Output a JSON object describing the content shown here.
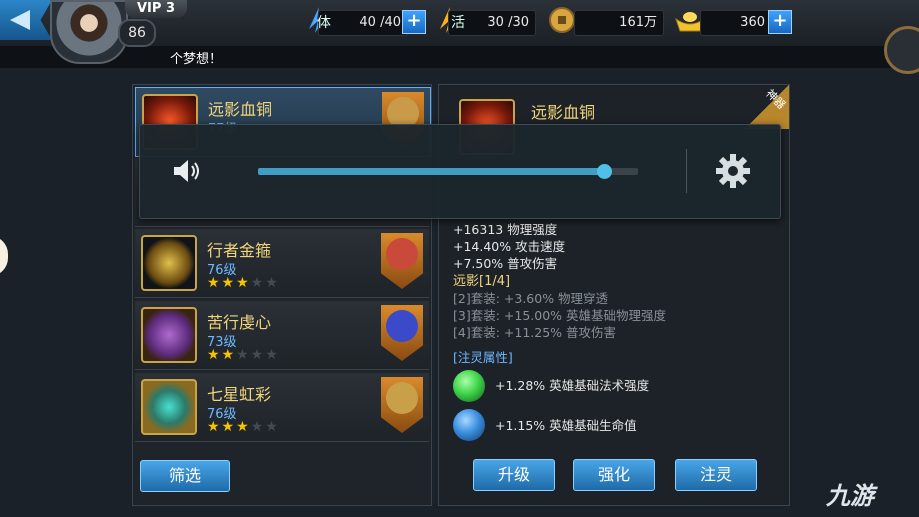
{
  "header": {
    "vip_label": "VIP 3",
    "player_level": "86",
    "stamina": {
      "icon": "stamina-icon",
      "label": "体",
      "value": "40 /40"
    },
    "vitality": {
      "icon": "vitality-icon",
      "label": "活",
      "value": "30 /30"
    },
    "coins": {
      "icon": "coin-icon",
      "value": "161万"
    },
    "ingots": {
      "icon": "ingot-icon",
      "value": "360"
    },
    "message": "个梦想！"
  },
  "equipment_list": [
    {
      "name": "远影血铜",
      "level": "77级",
      "stars": 0,
      "selected": true,
      "hero_color": "#c99a4a"
    },
    {
      "name": "",
      "level": "",
      "stars": 0,
      "selected": false,
      "hero_color": "#333"
    },
    {
      "name": "行者金箍",
      "level": "76级",
      "stars": 3,
      "selected": false,
      "hero_color": "#c94a3a"
    },
    {
      "name": "苦行虔心",
      "level": "73级",
      "stars": 2,
      "selected": false,
      "hero_color": "#3a4ac9"
    },
    {
      "name": "七星虹彩",
      "level": "76级",
      "stars": 3,
      "selected": false,
      "hero_color": "#c9a04a"
    }
  ],
  "filter_label": "筛选",
  "detail": {
    "name": "远影血铜",
    "tag": "神器",
    "stats": [
      "+16313 物理强度",
      "+14.40% 攻击速度",
      "+7.50% 普攻伤害"
    ],
    "set_title": "远影[1/4]",
    "set_bonuses": [
      "[2]套装: +3.60% 物理穿透",
      "[3]套装: +15.00% 英雄基础物理强度",
      "[4]套装: +11.25% 普攻伤害"
    ],
    "infuse_title": "[注灵属性]",
    "infuse": [
      {
        "text": "+1.28% 英雄基础法术强度",
        "color": "#3fd44a"
      },
      {
        "text": "+1.15% 英雄基础生命值",
        "color": "#3a8fe0"
      }
    ],
    "buttons": [
      "升级",
      "强化",
      "注灵"
    ]
  },
  "volume_overlay": {
    "speaker_icon": "speaker-icon",
    "volume_level": 0.91,
    "settings_icon": "gear-icon"
  },
  "watermark": "九游"
}
